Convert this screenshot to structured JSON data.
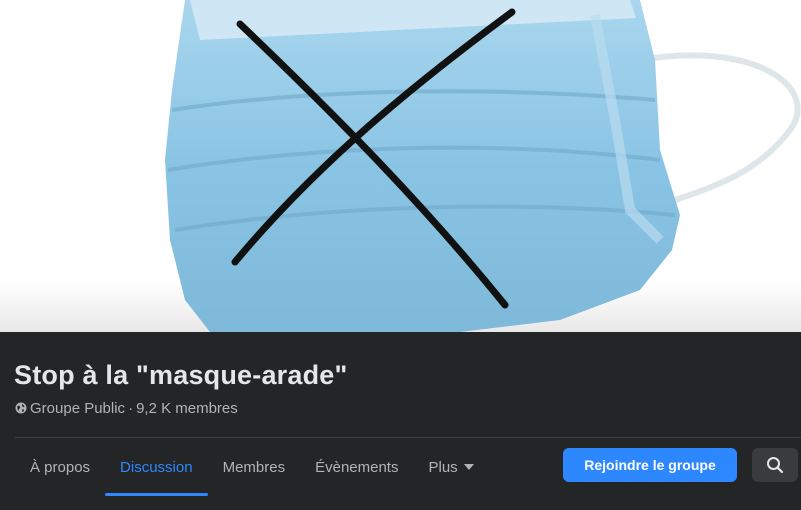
{
  "cover": {
    "image": "surgical-mask-crossed-out",
    "mask_color": "#8ec6e6",
    "cross_color": "#111111"
  },
  "group": {
    "title": "Stop à la \"masque-arade\"",
    "privacy": "Groupe Public",
    "separator": "·",
    "members": "9,2 K membres",
    "privacy_icon": "globe-icon"
  },
  "tabs": [
    {
      "label": "À propos",
      "active": false
    },
    {
      "label": "Discussion",
      "active": true
    },
    {
      "label": "Membres",
      "active": false
    },
    {
      "label": "Évènements",
      "active": false
    },
    {
      "label": "Plus",
      "active": false,
      "dropdown": true
    }
  ],
  "actions": {
    "join_label": "Rejoindre le groupe",
    "search_icon": "search-icon"
  },
  "colors": {
    "background": "#18191a",
    "header": "#242526",
    "accent": "#2d88ff",
    "primary_text": "#e4e6eb",
    "secondary_text": "#b0b3b8"
  }
}
